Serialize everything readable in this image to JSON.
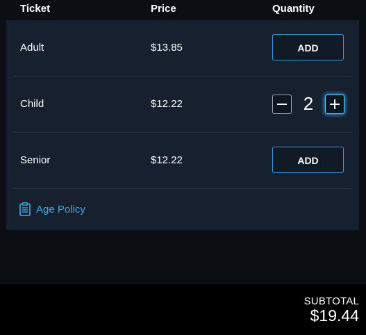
{
  "header": {
    "ticket": "Ticket",
    "price": "Price",
    "quantity": "Quantity"
  },
  "tickets": [
    {
      "name": "Adult",
      "price": "$13.85",
      "add_label": "ADD"
    },
    {
      "name": "Child",
      "price": "$12.22",
      "quantity": "2",
      "minus_icon": "minus-icon",
      "plus_icon": "plus-icon"
    },
    {
      "name": "Senior",
      "price": "$12.22",
      "add_label": "ADD"
    }
  ],
  "policy": {
    "label": "Age Policy",
    "icon": "clipboard-icon"
  },
  "footer": {
    "subtotal_label": "SUBTOTAL",
    "subtotal_value": "$19.44"
  },
  "colors": {
    "background": "#0b0e13",
    "panel": "#16202f",
    "accent": "#3fa9e6",
    "button_border": "#3a9ad9",
    "footer": "#000000"
  }
}
